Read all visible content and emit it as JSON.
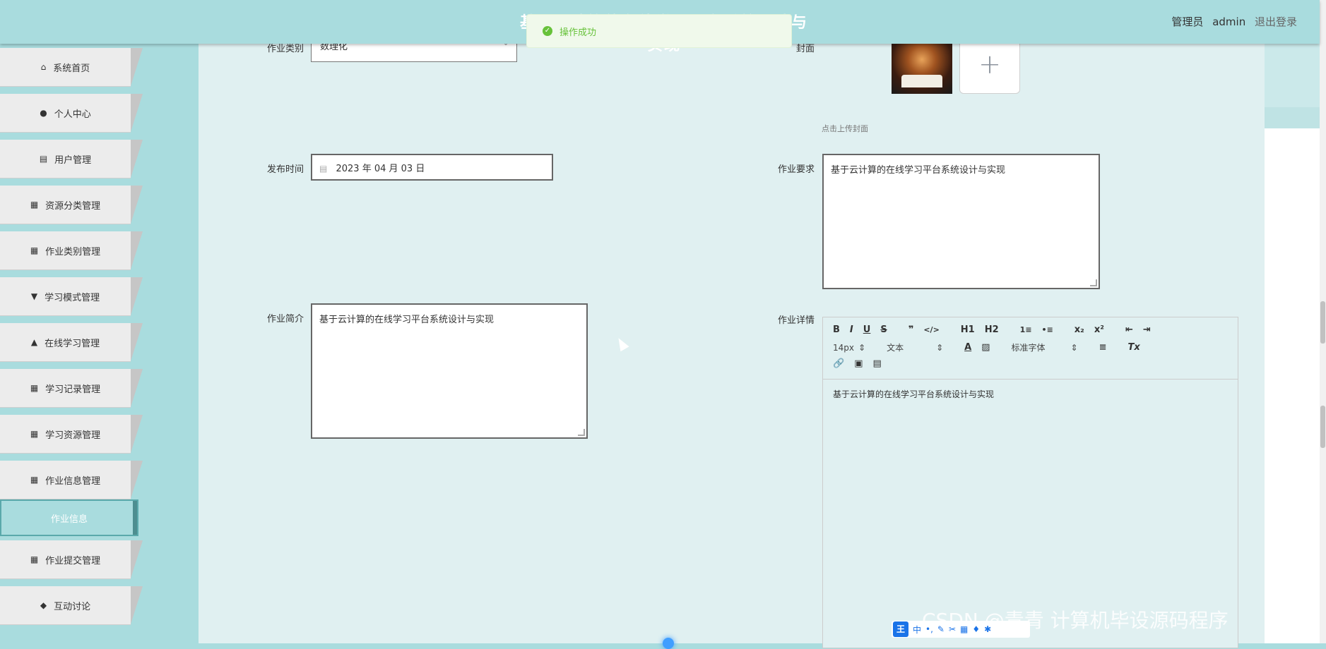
{
  "header": {
    "title": "基于云计算的在线学习平台系统设计与实现",
    "user_role": "管理员",
    "username": "admin",
    "logout": "退出登录"
  },
  "toast": {
    "message": "操作成功"
  },
  "sidebar": {
    "items": [
      {
        "label": "系统首页",
        "icon": "home-icon"
      },
      {
        "label": "个人中心",
        "icon": "user-icon"
      },
      {
        "label": "用户管理",
        "icon": "chart-icon"
      },
      {
        "label": "资源分类管理",
        "icon": "grid-icon"
      },
      {
        "label": "作业类别管理",
        "icon": "grid-icon"
      },
      {
        "label": "学习模式管理",
        "icon": "brush-icon"
      },
      {
        "label": "在线学习管理",
        "icon": "person-icon"
      },
      {
        "label": "学习记录管理",
        "icon": "grid-icon"
      },
      {
        "label": "学习资源管理",
        "icon": "grid-icon"
      },
      {
        "label": "作业信息管理",
        "icon": "grid-icon"
      },
      {
        "label": "作业提交管理",
        "icon": "grid-icon"
      },
      {
        "label": "互动讨论",
        "icon": "ticket-icon"
      }
    ],
    "active_sub": "作业信息"
  },
  "form": {
    "category_label": "作业类别",
    "category_value": "数理化",
    "cover_label": "封面",
    "cover_hint": "点击上传封面",
    "publish_label": "发布时间",
    "publish_value": "2023 年 04 月 03 日",
    "requirement_label": "作业要求",
    "requirement_value": "基于云计算的在线学习平台系统设计与实现",
    "intro_label": "作业简介",
    "intro_value": "基于云计算的在线学习平台系统设计与实现",
    "detail_label": "作业详情",
    "detail_value": "基于云计算的在线学习平台系统设计与实现"
  },
  "editor_toolbar": {
    "row1": [
      "B",
      "I",
      "U",
      "S",
      "❞",
      "</>",
      "H1",
      "H2",
      "1≡",
      "•≡",
      "x₂",
      "x²",
      "⇤",
      "⇥"
    ],
    "font_size": "14px",
    "paragraph": "文本",
    "font_family": "标准字体",
    "clear": "Tx"
  },
  "overlay": {
    "watermark": "CSDN @青青  计算机毕设源码程序",
    "ime_badge": "王",
    "ime_mode": "中"
  }
}
